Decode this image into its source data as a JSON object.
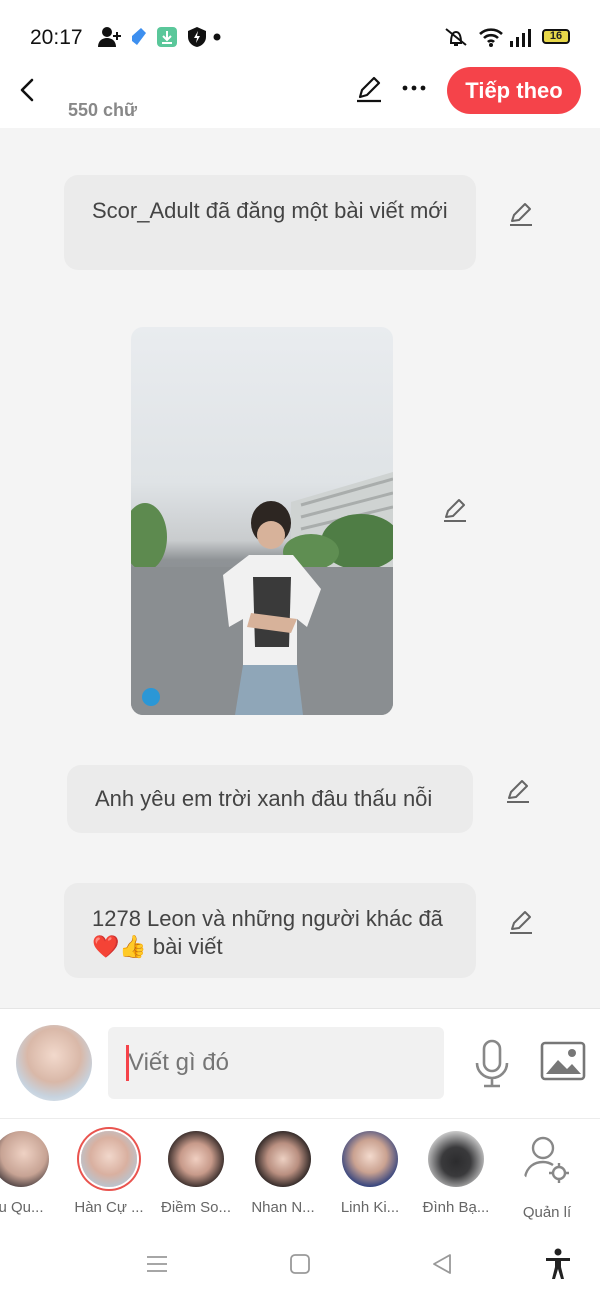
{
  "status_bar": {
    "time": "20:17",
    "battery": "16"
  },
  "header": {
    "word_count": "550 chữ",
    "next_label": "Tiếp theo"
  },
  "content": {
    "bubble1": "Scor_Adult đã đăng một bài viết mới",
    "bubble2": "Anh yêu em trời xanh đâu thấu nỗi",
    "bubble3": "1278 Leon và những người khác đã ❤️👍 bài viết"
  },
  "composer": {
    "placeholder": "Viết gì đó"
  },
  "friends": [
    {
      "name": "u Qu..."
    },
    {
      "name": "Hàn Cự ..."
    },
    {
      "name": "Điềm So..."
    },
    {
      "name": "Nhan N..."
    },
    {
      "name": "Linh Ki..."
    },
    {
      "name": "Đình Bạ..."
    },
    {
      "name": "Quản lí"
    }
  ],
  "colors": {
    "accent": "#f5434a"
  },
  "icons": [
    "back-icon",
    "edit-icon",
    "more-icon",
    "mic-icon",
    "image-icon",
    "manage-user-icon",
    "menu-icon",
    "home-icon",
    "back-nav-icon",
    "accessibility-icon"
  ]
}
